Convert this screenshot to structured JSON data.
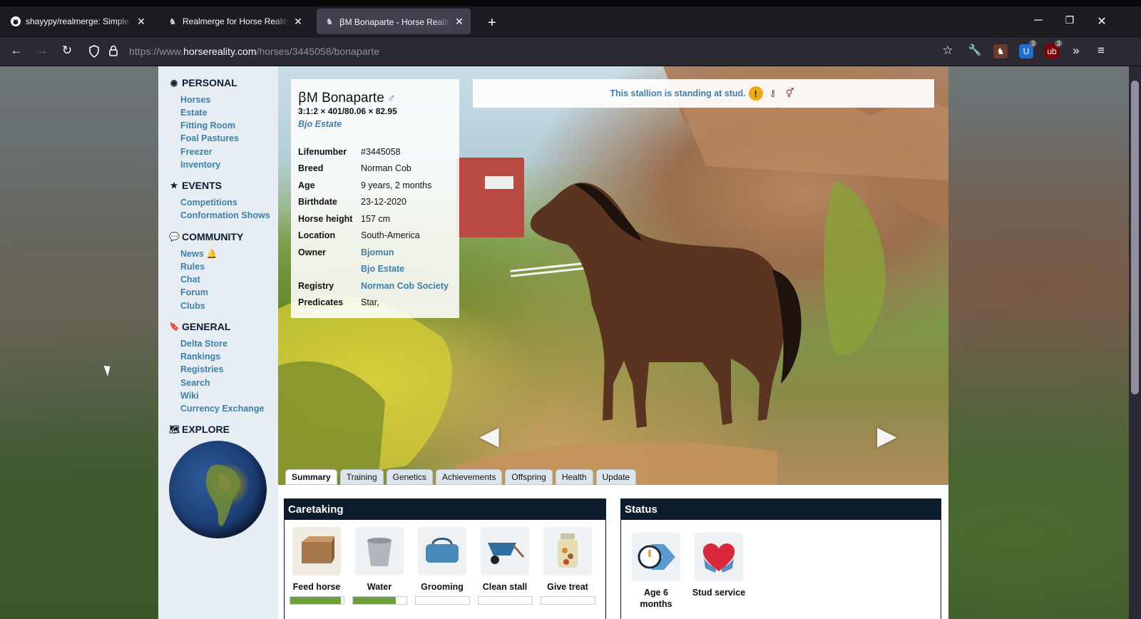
{
  "browser": {
    "tabs": [
      {
        "title": "shayypy/realmerge: Simple tool",
        "icon": "github-icon",
        "active": false
      },
      {
        "title": "Realmerge for Horse Reality",
        "icon": "horse-reality-icon",
        "active": false
      },
      {
        "title": "ꞵM Bonaparte - Horse Reality",
        "icon": "horse-reality-icon",
        "active": true
      }
    ],
    "new_tab": "+",
    "url_prefix": "https://www.",
    "url_domain": "horsereality.com",
    "url_path": "/horses/3445058/bonaparte",
    "extension_badges": [
      "3",
      "3"
    ]
  },
  "sidebar": {
    "personal": {
      "heading": "PERSONAL",
      "items": [
        "Horses",
        "Estate",
        "Fitting Room",
        "Foal Pastures",
        "Freezer",
        "Inventory"
      ]
    },
    "events": {
      "heading": "EVENTS",
      "items": [
        "Competitions",
        "Conformation Shows"
      ]
    },
    "community": {
      "heading": "COMMUNITY",
      "items": [
        "News",
        "Rules",
        "Chat",
        "Forum",
        "Clubs"
      ]
    },
    "general": {
      "heading": "GENERAL",
      "items": [
        "Delta Store",
        "Rankings",
        "Registries",
        "Search",
        "Wiki",
        "Currency Exchange"
      ]
    },
    "explore": {
      "heading": "EXPLORE"
    }
  },
  "horse": {
    "name": "ꞵM Bonaparte",
    "sex_symbol": "♂",
    "genotype": "3:1:2 × 401/80.06 × 82.95",
    "estate": "Bjo Estate",
    "details": [
      {
        "key": "Lifenumber",
        "value": "#3445058",
        "link": false
      },
      {
        "key": "Breed",
        "value": "Norman Cob",
        "link": false
      },
      {
        "key": "Age",
        "value": "9 years, 2 months",
        "link": false
      },
      {
        "key": "Birthdate",
        "value": "23-12-2020",
        "link": false
      },
      {
        "key": "Horse height",
        "value": "157 cm",
        "link": false
      },
      {
        "key": "Location",
        "value": "South-America",
        "link": false
      },
      {
        "key": "Owner",
        "value": "Bjomun",
        "link": true
      },
      {
        "key": "",
        "value": "Bjo Estate",
        "link": true
      },
      {
        "key": "Registry",
        "value": "Norman Cob Society",
        "link": true
      },
      {
        "key": "Predicates",
        "value": "Star,",
        "link": false
      }
    ],
    "stud_notice": "This stallion is standing at stud."
  },
  "page_tabs": [
    "Summary",
    "Training",
    "Genetics",
    "Achievements",
    "Offspring",
    "Health",
    "Update"
  ],
  "caretaking": {
    "heading": "Caretaking",
    "items": [
      {
        "label": "Feed horse",
        "icon": "hay-bale-icon",
        "level": 0.95
      },
      {
        "label": "Water",
        "icon": "bucket-icon",
        "level": 0.8
      },
      {
        "label": "Grooming",
        "icon": "grooming-bag-icon",
        "level": 0
      },
      {
        "label": "Clean stall",
        "icon": "wheelbarrow-icon",
        "level": 0
      },
      {
        "label": "Give treat",
        "icon": "treat-jar-icon",
        "level": 0
      }
    ]
  },
  "status": {
    "heading": "Status",
    "items": [
      {
        "label": "Age 6 months",
        "icon": "age-timer-icon"
      },
      {
        "label": "Stud service",
        "icon": "stud-heart-icon"
      }
    ]
  },
  "colors": {
    "link": "#3f7fa8",
    "navy": "#0c1c2c",
    "sidebar_bg": "#e6eef4",
    "bar_fill": "#70a040"
  }
}
